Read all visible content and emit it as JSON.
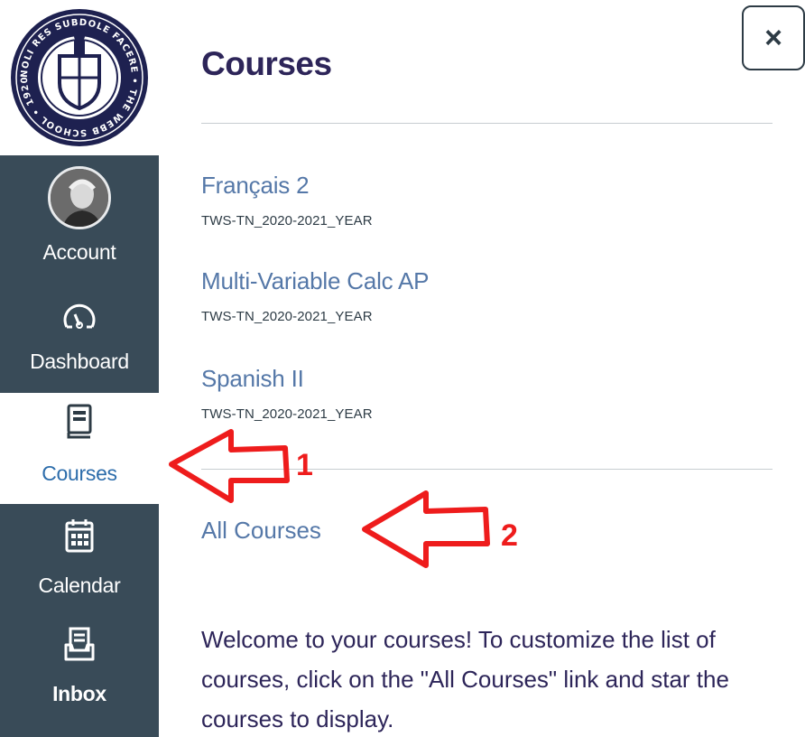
{
  "logo": {
    "text": "NOLI RES SUBDOLE FACERE • THE WEBB SCHOOL • 1920"
  },
  "nav": {
    "items": [
      {
        "label": "Account",
        "icon": "avatar-photo"
      },
      {
        "label": "Dashboard",
        "icon": "speedometer-icon"
      },
      {
        "label": "Courses",
        "icon": "book-icon",
        "active": true
      },
      {
        "label": "Calendar",
        "icon": "calendar-icon"
      },
      {
        "label": "Inbox",
        "icon": "inbox-icon"
      }
    ]
  },
  "tray": {
    "close_label": "×",
    "title": "Courses",
    "courses": [
      {
        "name": "Français 2",
        "term": "TWS-TN_2020-2021_YEAR"
      },
      {
        "name": "Multi-Variable Calc AP",
        "term": "TWS-TN_2020-2021_YEAR"
      },
      {
        "name": "Spanish II",
        "term": "TWS-TN_2020-2021_YEAR"
      }
    ],
    "all_courses_label": "All Courses",
    "welcome_text": "Welcome to your courses! To customize the list of courses, click on the \"All Courses\" link and star the courses to display."
  },
  "annotations": {
    "arrow_1_number": "1",
    "arrow_2_number": "2",
    "color": "#ee1c1c"
  },
  "colors": {
    "nav_dark": "#394b58",
    "title": "#2d2559",
    "link": "#5578a8",
    "active_label": "#2d6dab"
  }
}
